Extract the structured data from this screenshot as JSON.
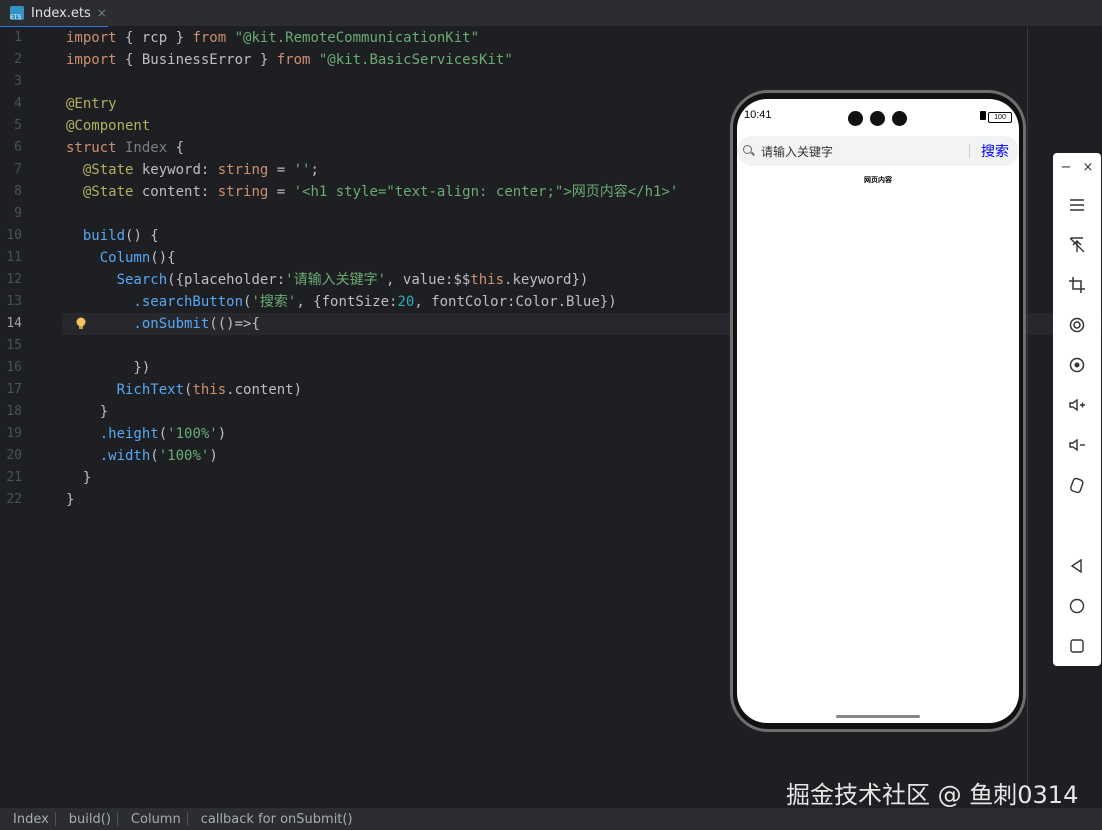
{
  "tab": {
    "label": "Index.ets",
    "close": "×"
  },
  "code": {
    "line_numbers": [
      "1",
      "2",
      "3",
      "4",
      "5",
      "6",
      "7",
      "8",
      "9",
      "10",
      "11",
      "12",
      "13",
      "14",
      "15",
      "16",
      "17",
      "18",
      "19",
      "20",
      "21",
      "22"
    ],
    "active_line": "14",
    "lines": [
      [
        {
          "t": "import",
          "c": "kw"
        },
        {
          "t": " { rcp } ",
          "c": ""
        },
        {
          "t": "from",
          "c": "kw"
        },
        {
          "t": " \"@kit.RemoteCommunicationKit\"",
          "c": "str"
        }
      ],
      [
        {
          "t": "import",
          "c": "kw"
        },
        {
          "t": " { BusinessError } ",
          "c": ""
        },
        {
          "t": "from",
          "c": "kw"
        },
        {
          "t": " \"@kit.BasicServicesKit\"",
          "c": "str"
        }
      ],
      [],
      [
        {
          "t": "@Entry",
          "c": "dec"
        }
      ],
      [
        {
          "t": "@Component",
          "c": "dec"
        }
      ],
      [
        {
          "t": "struct",
          "c": "kw"
        },
        {
          "t": " Index ",
          "c": "dim"
        },
        {
          "t": "{",
          "c": ""
        }
      ],
      [
        {
          "t": "  @State",
          "c": "dec"
        },
        {
          "t": " keyword: ",
          "c": ""
        },
        {
          "t": "string",
          "c": "kw"
        },
        {
          "t": " = ",
          "c": ""
        },
        {
          "t": "''",
          "c": "str"
        },
        {
          "t": ";",
          "c": ""
        }
      ],
      [
        {
          "t": "  @State",
          "c": "dec"
        },
        {
          "t": " content: ",
          "c": ""
        },
        {
          "t": "string",
          "c": "kw"
        },
        {
          "t": " = ",
          "c": ""
        },
        {
          "t": "'<h1 style=\"text-align: center;\">网页内容</h1>'",
          "c": "str"
        }
      ],
      [],
      [
        {
          "t": "  build",
          "c": "fn"
        },
        {
          "t": "() {",
          "c": ""
        }
      ],
      [
        {
          "t": "    Column",
          "c": "fn"
        },
        {
          "t": "(){",
          "c": ""
        }
      ],
      [
        {
          "t": "      Search",
          "c": "fn"
        },
        {
          "t": "({placeholder:",
          "c": ""
        },
        {
          "t": "'请输入关键字'",
          "c": "str"
        },
        {
          "t": ", value:$$",
          "c": ""
        },
        {
          "t": "this",
          "c": "kw"
        },
        {
          "t": ".keyword})",
          "c": ""
        }
      ],
      [
        {
          "t": "        .searchButton",
          "c": "fn"
        },
        {
          "t": "(",
          "c": ""
        },
        {
          "t": "'搜索'",
          "c": "str"
        },
        {
          "t": ", {fontSize:",
          "c": ""
        },
        {
          "t": "20",
          "c": "num"
        },
        {
          "t": ", fontColor:Color.Blue})",
          "c": ""
        }
      ],
      [
        {
          "t": "        .onSubmit",
          "c": "fn"
        },
        {
          "t": "(()=>{",
          "c": ""
        }
      ],
      [],
      [
        {
          "t": "        })",
          "c": ""
        }
      ],
      [
        {
          "t": "      RichText",
          "c": "fn"
        },
        {
          "t": "(",
          "c": ""
        },
        {
          "t": "this",
          "c": "kw"
        },
        {
          "t": ".content)",
          "c": ""
        }
      ],
      [
        {
          "t": "    }",
          "c": ""
        }
      ],
      [
        {
          "t": "    .height",
          "c": "fn"
        },
        {
          "t": "(",
          "c": ""
        },
        {
          "t": "'100%'",
          "c": "str"
        },
        {
          "t": ")",
          "c": ""
        }
      ],
      [
        {
          "t": "    .width",
          "c": "fn"
        },
        {
          "t": "(",
          "c": ""
        },
        {
          "t": "'100%'",
          "c": "str"
        },
        {
          "t": ")",
          "c": ""
        }
      ],
      [
        {
          "t": "  }",
          "c": ""
        }
      ],
      [
        {
          "t": "}",
          "c": ""
        }
      ]
    ]
  },
  "phone": {
    "time": "10:41",
    "battery": "100",
    "search_placeholder": "请输入关键字",
    "search_button": "搜索",
    "rich_text": "网页内容"
  },
  "toolbar": {
    "minimize": "−",
    "close": "×",
    "items": [
      "menu-icon",
      "pin-off-icon",
      "crop-icon",
      "rotate-icon",
      "screenshot-icon",
      "volume-up-icon",
      "volume-down-icon",
      "shake-icon",
      "back-icon",
      "home-icon",
      "recents-icon"
    ]
  },
  "watermark": "掘金技术社区 @ 鱼刺0314",
  "breadcrumbs": [
    "Index",
    "build()",
    "Column",
    "callback for onSubmit()"
  ]
}
